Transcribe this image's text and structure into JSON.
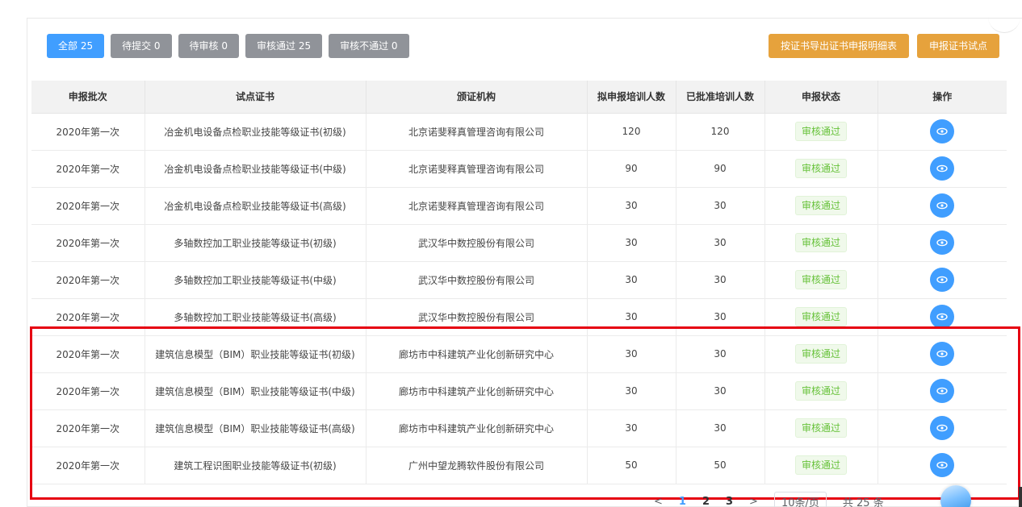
{
  "filters": [
    {
      "label": "全部 25",
      "active": true
    },
    {
      "label": "待提交 0",
      "active": false
    },
    {
      "label": "待审核 0",
      "active": false
    },
    {
      "label": "审核通过 25",
      "active": false
    },
    {
      "label": "审核不通过 0",
      "active": false
    }
  ],
  "actions": {
    "export_label": "按证书导出证书申报明细表",
    "apply_label": "申报证书试点"
  },
  "table": {
    "columns": [
      "申报批次",
      "试点证书",
      "颁证机构",
      "拟申报培训人数",
      "已批准培训人数",
      "申报状态",
      "操作"
    ],
    "rows": [
      {
        "batch": "2020年第一次",
        "certificate": "冶金机电设备点检职业技能等级证书(初级)",
        "issuer": "北京诺斐释真管理咨询有限公司",
        "planned": "120",
        "approved": "120",
        "status": "审核通过"
      },
      {
        "batch": "2020年第一次",
        "certificate": "冶金机电设备点检职业技能等级证书(中级)",
        "issuer": "北京诺斐释真管理咨询有限公司",
        "planned": "90",
        "approved": "90",
        "status": "审核通过"
      },
      {
        "batch": "2020年第一次",
        "certificate": "冶金机电设备点检职业技能等级证书(高级)",
        "issuer": "北京诺斐释真管理咨询有限公司",
        "planned": "30",
        "approved": "30",
        "status": "审核通过"
      },
      {
        "batch": "2020年第一次",
        "certificate": "多轴数控加工职业技能等级证书(初级)",
        "issuer": "武汉华中数控股份有限公司",
        "planned": "30",
        "approved": "30",
        "status": "审核通过"
      },
      {
        "batch": "2020年第一次",
        "certificate": "多轴数控加工职业技能等级证书(中级)",
        "issuer": "武汉华中数控股份有限公司",
        "planned": "30",
        "approved": "30",
        "status": "审核通过"
      },
      {
        "batch": "2020年第一次",
        "certificate": "多轴数控加工职业技能等级证书(高级)",
        "issuer": "武汉华中数控股份有限公司",
        "planned": "30",
        "approved": "30",
        "status": "审核通过"
      },
      {
        "batch": "2020年第一次",
        "certificate": "建筑信息模型（BIM）职业技能等级证书(初级)",
        "issuer": "廊坊市中科建筑产业化创新研究中心",
        "planned": "30",
        "approved": "30",
        "status": "审核通过"
      },
      {
        "batch": "2020年第一次",
        "certificate": "建筑信息模型（BIM）职业技能等级证书(中级)",
        "issuer": "廊坊市中科建筑产业化创新研究中心",
        "planned": "30",
        "approved": "30",
        "status": "审核通过"
      },
      {
        "batch": "2020年第一次",
        "certificate": "建筑信息模型（BIM）职业技能等级证书(高级)",
        "issuer": "廊坊市中科建筑产业化创新研究中心",
        "planned": "30",
        "approved": "30",
        "status": "审核通过"
      },
      {
        "batch": "2020年第一次",
        "certificate": "建筑工程识图职业技能等级证书(初级)",
        "issuer": "广州中望龙腾软件股份有限公司",
        "planned": "50",
        "approved": "50",
        "status": "审核通过"
      }
    ]
  },
  "pagination": {
    "prev": "<",
    "pages": [
      "1",
      "2",
      "3"
    ],
    "next": ">",
    "page_size": "10条/页",
    "total": "共 25 条"
  },
  "colors": {
    "primary": "#409eff",
    "gray_button": "#909399",
    "orange_button": "#e6a23c",
    "success_text": "#67c23a",
    "highlight_border": "#e60012"
  }
}
